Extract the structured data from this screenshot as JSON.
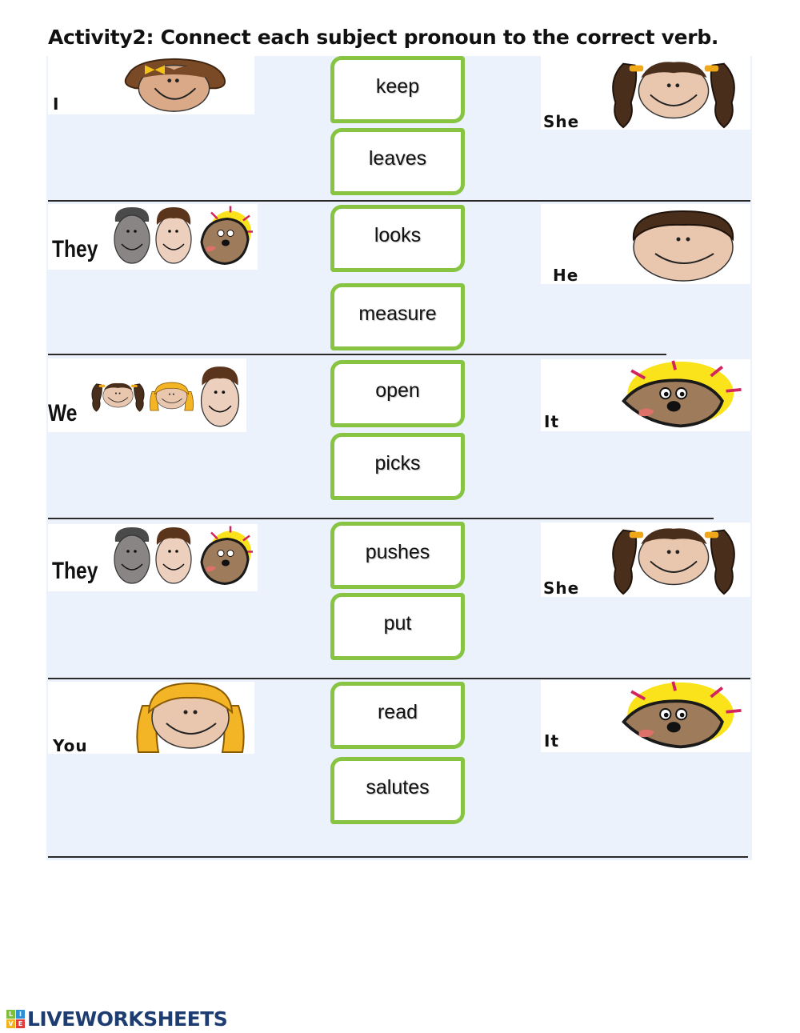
{
  "title": "Activity2: Connect each subject pronoun to the correct verb.",
  "rows": [
    {
      "left": {
        "pronoun": "I",
        "picture": "girl-brown-hair-bow"
      },
      "right": {
        "pronoun": "She",
        "picture": "girl-pigtails"
      },
      "verbs": [
        "keep",
        "leaves"
      ]
    },
    {
      "left": {
        "pronoun": "They",
        "picture": "two-boys-and-dog"
      },
      "right": {
        "pronoun": "He",
        "picture": "boy"
      },
      "verbs": [
        "looks",
        "measure"
      ]
    },
    {
      "left": {
        "pronoun": "We",
        "picture": "three-girls"
      },
      "right": {
        "pronoun": "It",
        "picture": "dog"
      },
      "verbs": [
        "open",
        "picks"
      ]
    },
    {
      "left": {
        "pronoun": "They",
        "picture": "two-boys-and-dog"
      },
      "right": {
        "pronoun": "She",
        "picture": "girl-pigtails"
      },
      "verbs": [
        "pushes",
        "put"
      ]
    },
    {
      "left": {
        "pronoun": "You",
        "picture": "girl-blonde"
      },
      "right": {
        "pronoun": "It",
        "picture": "dog"
      },
      "verbs": [
        "read",
        "salutes"
      ]
    }
  ],
  "colors": {
    "verb_border": "#86c442",
    "panel_bg": "#ebf2fb",
    "logo_text": "#1d3d72"
  },
  "footer": {
    "logo_letters": [
      "L",
      "I",
      "V",
      "E"
    ],
    "logo_text": "LIVEWORKSHEETS"
  }
}
